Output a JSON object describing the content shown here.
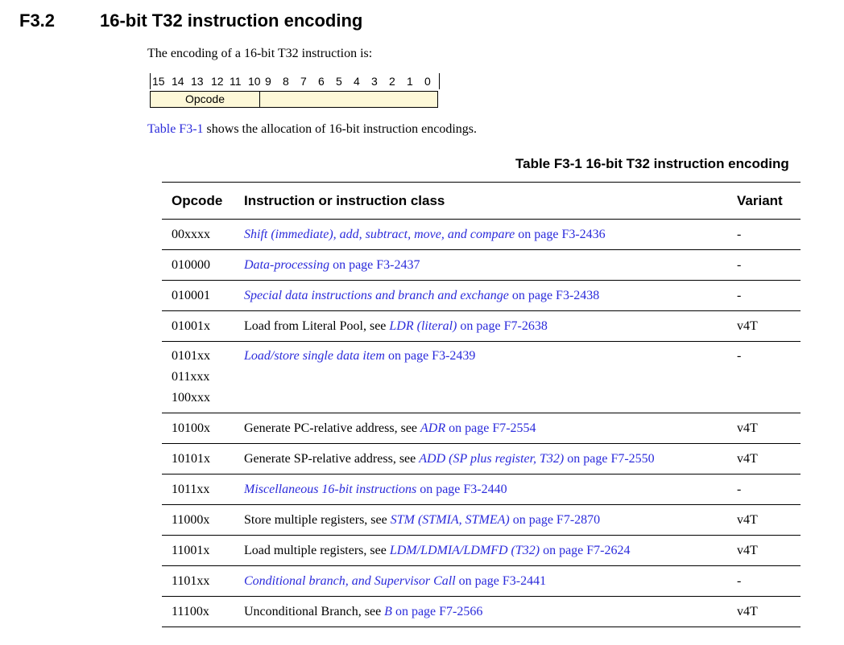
{
  "section": {
    "number": "F3.2",
    "title": "16-bit T32 instruction encoding"
  },
  "intro": "The encoding of a 16-bit T32 instruction is:",
  "bitfield": {
    "bits": [
      "15",
      "14",
      "13",
      "12",
      "11",
      "10",
      "9",
      "8",
      "7",
      "6",
      "5",
      "4",
      "3",
      "2",
      "1",
      "0"
    ],
    "fields": [
      {
        "label": "Opcode"
      },
      {
        "label": ""
      }
    ]
  },
  "table_ref": {
    "link": "Table F3-1",
    "text": " shows the allocation of 16-bit instruction encodings."
  },
  "table": {
    "caption": "Table F3-1 16-bit T32 instruction encoding",
    "headers": {
      "opcode": "Opcode",
      "instruction": "Instruction or instruction class",
      "variant": "Variant"
    },
    "rows": [
      {
        "opcode": [
          "00xxxx"
        ],
        "prefix": "",
        "link": "Shift (immediate), add, subtract, move, and compare",
        "page": " on page F3-2436",
        "variant": "-"
      },
      {
        "opcode": [
          "010000"
        ],
        "prefix": "",
        "link": "Data-processing",
        "page": " on page F3-2437",
        "variant": "-"
      },
      {
        "opcode": [
          "010001"
        ],
        "prefix": "",
        "link": "Special data instructions and branch and exchange",
        "page": " on page F3-2438",
        "variant": "-"
      },
      {
        "opcode": [
          "01001x"
        ],
        "prefix": "Load from Literal Pool, see ",
        "link": "LDR (literal)",
        "page": " on page F7-2638",
        "variant": "v4T"
      },
      {
        "opcode": [
          "0101xx",
          "011xxx",
          "100xxx"
        ],
        "prefix": "",
        "link": "Load/store single data item",
        "page": " on page F3-2439",
        "variant": "-"
      },
      {
        "opcode": [
          "10100x"
        ],
        "prefix": "Generate PC-relative address, see ",
        "link": "ADR",
        "page": " on page F7-2554",
        "variant": "v4T"
      },
      {
        "opcode": [
          "10101x"
        ],
        "prefix": "Generate SP-relative address, see ",
        "link": "ADD (SP plus register, T32)",
        "page": " on page F7-2550",
        "variant": "v4T"
      },
      {
        "opcode": [
          "1011xx"
        ],
        "prefix": "",
        "link": "Miscellaneous 16-bit instructions",
        "page": " on page F3-2440",
        "variant": "-"
      },
      {
        "opcode": [
          "11000x"
        ],
        "prefix": "Store multiple registers, see ",
        "link": "STM (STMIA, STMEA)",
        "page": " on page F7-2870",
        "variant": "v4T"
      },
      {
        "opcode": [
          "11001x"
        ],
        "prefix": "Load multiple registers, see ",
        "link": "LDM/LDMIA/LDMFD (T32)",
        "page": " on page F7-2624",
        "variant": "v4T"
      },
      {
        "opcode": [
          "1101xx"
        ],
        "prefix": "",
        "link": "Conditional branch, and Supervisor Call",
        "page": " on page F3-2441",
        "variant": "-"
      },
      {
        "opcode": [
          "11100x"
        ],
        "prefix": "Unconditional Branch, see ",
        "link": "B",
        "page": " on page F7-2566",
        "variant": "v4T"
      }
    ]
  }
}
